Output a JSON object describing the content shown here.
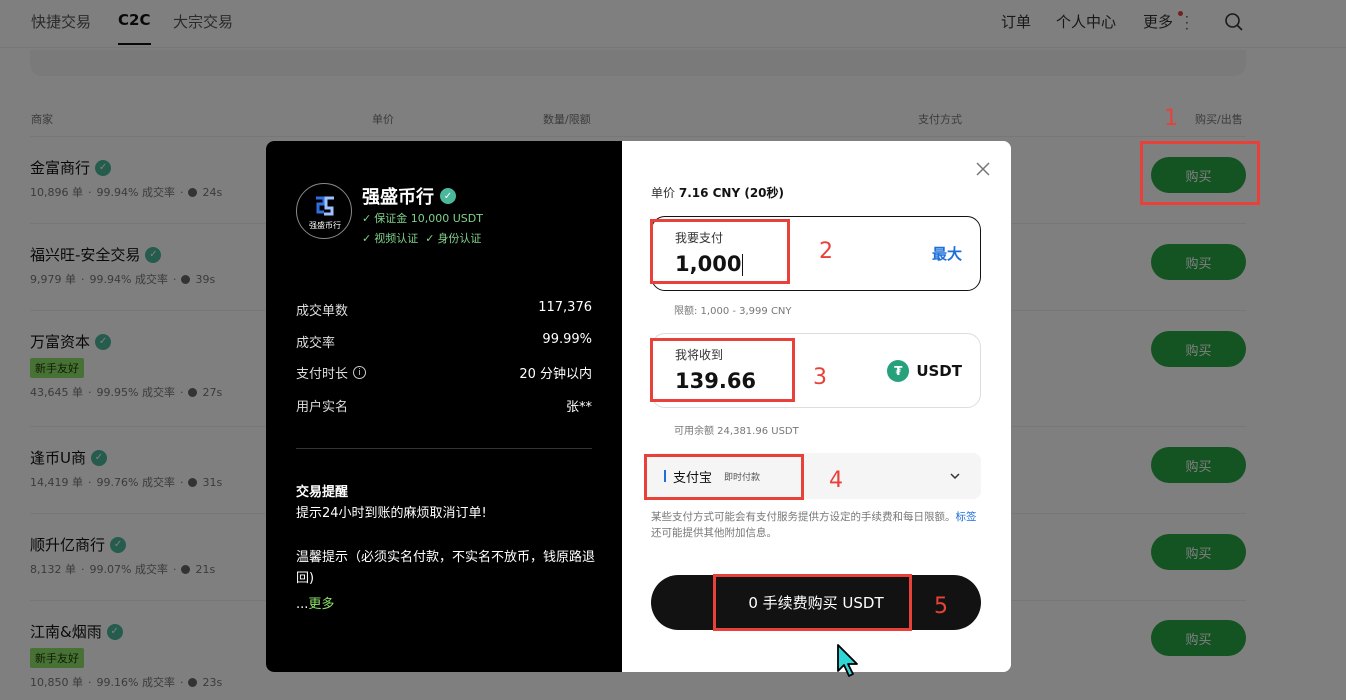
{
  "topnav": {
    "tabs": [
      {
        "label": "快捷交易"
      },
      {
        "label": "C2C"
      },
      {
        "label": "大宗交易"
      }
    ],
    "right": [
      {
        "label": "订单"
      },
      {
        "label": "个人中心"
      },
      {
        "label": "更多"
      }
    ]
  },
  "table": {
    "columns": [
      "商家",
      "单价",
      "数量/限额",
      "支付方式",
      "购买/出售"
    ],
    "rows": [
      {
        "name": "金富商行",
        "orders": "10,896 单",
        "rate": "99.94% 成交率",
        "time": "24s",
        "badge": "",
        "action": "购买"
      },
      {
        "name": "福兴旺-安全交易",
        "orders": "9,979 单",
        "rate": "99.94% 成交率",
        "time": "39s",
        "badge": "",
        "action": "购买"
      },
      {
        "name": "万富资本",
        "orders": "43,645 单",
        "rate": "99.95% 成交率",
        "time": "27s",
        "badge": "新手友好",
        "action": "购买"
      },
      {
        "name": "逢币U商",
        "orders": "14,419 单",
        "rate": "99.76% 成交率",
        "time": "31s",
        "badge": "",
        "action": "购买"
      },
      {
        "name": "顺升亿商行",
        "orders": "8,132 单",
        "rate": "99.07% 成交率",
        "time": "21s",
        "badge": "",
        "action": "购买"
      },
      {
        "name": "江南&烟雨",
        "orders": "10,850 单",
        "rate": "99.16% 成交率",
        "time": "23s",
        "badge": "新手友好",
        "action": "购买"
      }
    ]
  },
  "modal": {
    "merchant": {
      "logo_text": "强盛币行",
      "name": "强盛币行",
      "deposit": "保证金 10,000 USDT",
      "video_verify": "视频认证",
      "id_verify": "身份认证"
    },
    "stats": [
      {
        "label": "成交单数",
        "value": "117,376"
      },
      {
        "label": "成交率",
        "value": "99.99%"
      },
      {
        "label": "支付时长",
        "value": "20 分钟以内"
      },
      {
        "label": "用户实名",
        "value": "张**"
      }
    ],
    "remind_title": "交易提醒",
    "remind_line1": "提示24小时到账的麻烦取消订单!",
    "remind_line2": "温馨提示（必须实名付款，不实名不放币，钱原路退回)",
    "more_prefix": "...",
    "more_label": "更多",
    "price_label": "单价",
    "price_value": "7.16 CNY (20秒)",
    "pay": {
      "label": "我要支付",
      "value": "1,000",
      "max": "最大",
      "limit": "限额: 1,000 - 3,999 CNY"
    },
    "receive": {
      "label": "我将收到",
      "value": "139.66",
      "currency": "USDT",
      "balance": "可用余额 24,381.96 USDT"
    },
    "method": {
      "name": "支付宝",
      "sub": "即时付款"
    },
    "notice_before": "某些支付方式可能会有支付服务提供方设定的手续费和每日限额。",
    "notice_link": "标签",
    "notice_after": " 还可能提供其他附加信息。",
    "submit": "0 手续费购买 USDT"
  },
  "annotations": [
    "1",
    "2",
    "3",
    "4",
    "5"
  ],
  "colors": {
    "accent_green": "#28a745",
    "link_blue": "#1e6fd9",
    "annotation_red": "#e8413a",
    "tether": "#26a17b"
  }
}
